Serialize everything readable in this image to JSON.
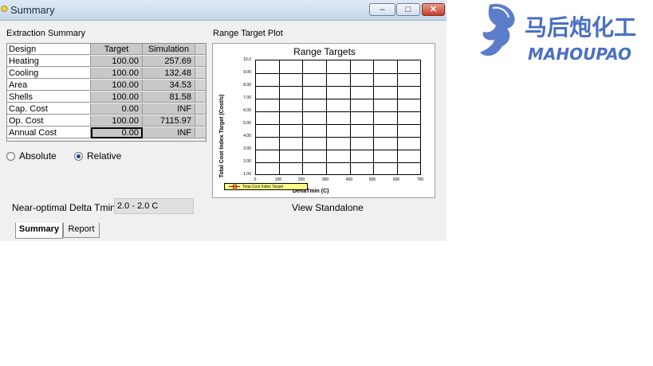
{
  "window": {
    "title": "Summary",
    "minimize": "–",
    "maximize": "□",
    "close": "✕"
  },
  "extraction": {
    "label": "Extraction Summary",
    "headers": [
      "Design",
      "Target",
      "Simulation"
    ],
    "rows": [
      [
        "Heating",
        "100.00",
        "257.69"
      ],
      [
        "Cooling",
        "100.00",
        "132.48"
      ],
      [
        "Area",
        "100.00",
        "34.53"
      ],
      [
        "Shells",
        "100.00",
        "81.58"
      ],
      [
        "Cap. Cost",
        "0.00",
        "INF"
      ],
      [
        "Op. Cost",
        "100.00",
        "7115.97"
      ],
      [
        "Annual Cost",
        "0.00",
        "INF"
      ]
    ]
  },
  "radios": {
    "absolute": "Absolute",
    "relative": "Relative",
    "selected": "relative"
  },
  "near_optimal": {
    "label": "Near-optimal Delta Tmin:",
    "value": "2.0 - 2.0 C"
  },
  "plot": {
    "section_label": "Range Target Plot",
    "view_standalone": "View Standalone"
  },
  "chart_data": {
    "type": "line",
    "title": "Range Targets",
    "xlabel": "DeltaTmin (C)",
    "ylabel": "Total Cost Index Target (Cost/s)",
    "xlim": [
      0,
      700
    ],
    "ylim": [
      1.0,
      10.0
    ],
    "x_ticks": [
      "0",
      "100",
      "200",
      "300",
      "400",
      "500",
      "600",
      "700"
    ],
    "y_ticks": [
      "1.00",
      "2.00",
      "3.00",
      "4.00",
      "5.00",
      "6.00",
      "7.00",
      "8.00",
      "9.00",
      "10.0"
    ],
    "series": [
      {
        "name": "Total Cost Index Target",
        "values": []
      }
    ],
    "grid": true,
    "legend_position": "bottom-left"
  },
  "tabs": [
    "Summary",
    "Report"
  ],
  "logo": {
    "text_cn": "马后炮化工",
    "text_en": "MAHOUPAO"
  },
  "colors": {
    "legend_bg": "#ffff88",
    "series": "#c00000",
    "logo": "#4a6fc4"
  }
}
